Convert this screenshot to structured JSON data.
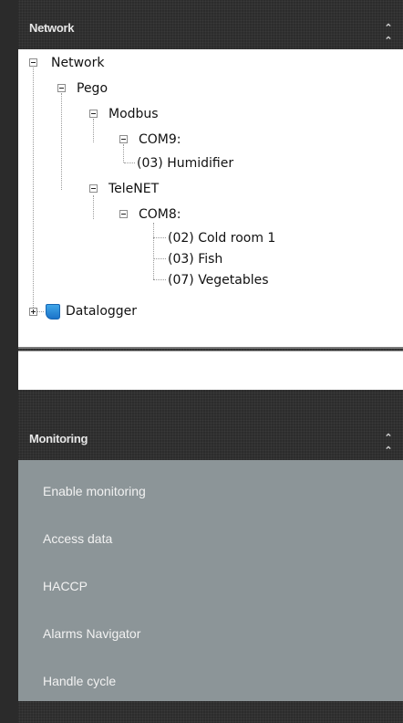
{
  "network": {
    "title": "Network",
    "tree": {
      "root": "Network",
      "pego": "Pego",
      "modbus": "Modbus",
      "com9": "COM9:",
      "humidifier": "(03) Humidifier",
      "telenet": "TeleNET",
      "com8": "COM8:",
      "cold_room": "(02) Cold room 1",
      "fish": "(03) Fish",
      "vegetables": "(07) Vegetables",
      "datalogger": "Datalogger"
    }
  },
  "monitoring": {
    "title": "Monitoring",
    "items": [
      "Enable monitoring",
      "Access data",
      "HACCP",
      "Alarms Navigator",
      "Handle cycle"
    ]
  },
  "colors": {
    "panel_dark": "#2c2c2c",
    "monitoring_bg": "#8c9598",
    "tree_bg": "#ffffff",
    "datalogger_icon": "#2a8ad8"
  }
}
